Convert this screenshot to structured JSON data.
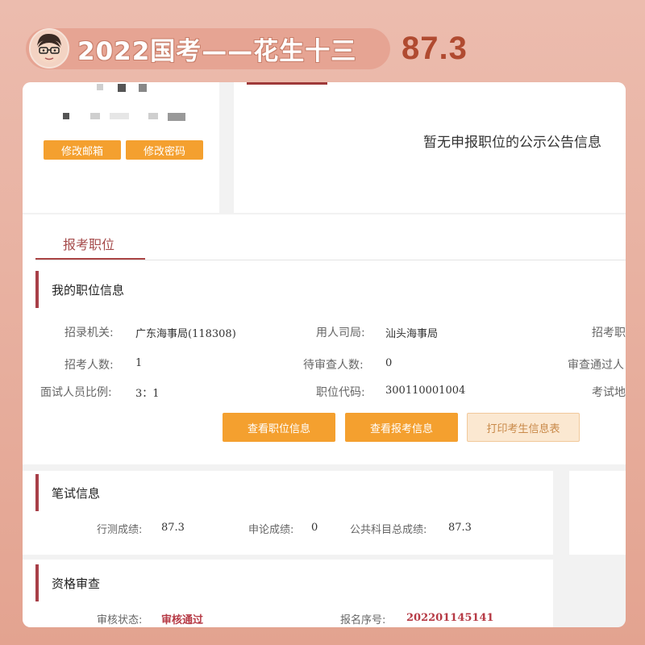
{
  "banner": {
    "title": "2022国考——花生十三",
    "score": "87.3"
  },
  "profile_card": {
    "buttons": [
      "修改邮箱",
      "修改密码"
    ]
  },
  "notice_card": {
    "message": "暂无申报职位的公示公告信息"
  },
  "tabs": [
    "报考职位"
  ],
  "position_info": {
    "heading": "我的职位信息",
    "rows": [
      [
        {
          "label": "招录机关:",
          "value": "广东海事局(118308)"
        },
        {
          "label": "用人司局:",
          "value": "汕头海事局"
        },
        {
          "label": "招考职",
          "value": ""
        }
      ],
      [
        {
          "label": "招考人数:",
          "value": "1"
        },
        {
          "label": "待审查人数:",
          "value": "0"
        },
        {
          "label": "审查通过人",
          "value": ""
        }
      ],
      [
        {
          "label": "面试人员比例:",
          "value": "3：1"
        },
        {
          "label": "职位代码:",
          "value": "300110001004"
        },
        {
          "label": "考试地",
          "value": ""
        }
      ]
    ],
    "actions": [
      "查看职位信息",
      "查看报考信息",
      "打印考生信息表"
    ]
  },
  "written_exam": {
    "heading": "笔试信息",
    "items": [
      {
        "label": "行测成绩:",
        "value": "87.3"
      },
      {
        "label": "申论成绩:",
        "value": "0"
      },
      {
        "label": "公共科目总成绩:",
        "value": "87.3"
      }
    ]
  },
  "qualification": {
    "heading": "资格审查",
    "status_label": "审核状态:",
    "status_value": "审核通过",
    "serial_label": "报名序号:",
    "serial_value": "202201145141"
  },
  "colors": {
    "accent": "#f4a02f",
    "section_bar": "#a83f48",
    "status_red": "#b63a45",
    "banner_bg": "#e6a493",
    "score_color": "#b04a30"
  }
}
